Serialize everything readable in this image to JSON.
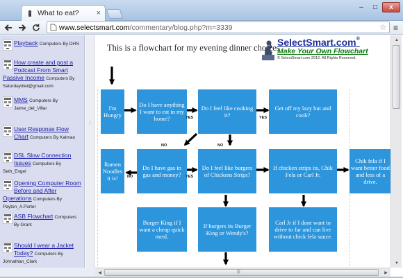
{
  "browser": {
    "tab_title": "What to eat?",
    "tab_close": "×",
    "url_domain": "www.selectsmart.com",
    "url_path": "/commentary/blog.php?m=3339",
    "win_min": "–",
    "win_max": "□",
    "win_close": "x"
  },
  "sidebar": {
    "items": [
      {
        "link": "Playback",
        "by": "Computers By DHN"
      },
      {
        "link": "How create and post a Podcast From Smart Passive Income",
        "by": "Computers By Saturdaydiet@gmail.com"
      },
      {
        "link": "MMS",
        "by": "Computers By Jaime_del_Villar"
      },
      {
        "link": "User Response Flow Chart",
        "by": "Computers By Kalmao"
      },
      {
        "link": "DSL Slow Connection Issues",
        "by": "Computers By Seth_Engel"
      },
      {
        "link": "Opening Computer Room Before and After Operations",
        "by": "Computers By Payton_A.Porter"
      },
      {
        "link": "ASB Flowchart",
        "by": "Computers By Grant"
      },
      {
        "link": "Should I wear a Jacket Today?",
        "by": "Computers By Johnathan_Clark"
      }
    ]
  },
  "main": {
    "page_title": "This is a flowchart for my evening dinner choices",
    "logo_name": "SelectSmart.com",
    "logo_reg": "®",
    "logo_tagline": "Make Your Own Flowchart",
    "logo_copyright": "© SelectSmart.com 2012. All Rights Reserved."
  },
  "flowchart": {
    "boxes": {
      "hungry": "I'm Hungry",
      "want_to_eat": "Do I have anything I want to eat in my home?",
      "feel_cooking": "Do I feel like cooking it?",
      "get_off": "Get off my lazy but and cook?",
      "ramen": "Ramen Noodles it is!",
      "gas_money": "Do I have gas in gas and money?",
      "burgers_strips": "Do I feel like burgers of Chickens Strips?",
      "chicken_strips": "If chicken strips its, Chik Fela or Carl Jr.",
      "chik_fela": "Chik fela if I want better food and less of a drive.",
      "burger_king": "Burger King if I want a cheap quick meal.",
      "bk_wendys": "If burgers its Burger King or Wendy's?",
      "carl_jr": "Carl Jr if I dont want to drive to far and can live without chick fela sauce."
    },
    "labels": {
      "yes1": "YES",
      "yes2": "YES",
      "no1": "NO",
      "no2": "NO",
      "no3": "NO",
      "yes3": "YES"
    }
  },
  "colors": {
    "box_fill": "#2c95dc",
    "sidebar_bg": "#d9ddef",
    "link": "#1a1aa6",
    "logo_blue": "#1d2f9c",
    "logo_green": "#0d7a12"
  }
}
